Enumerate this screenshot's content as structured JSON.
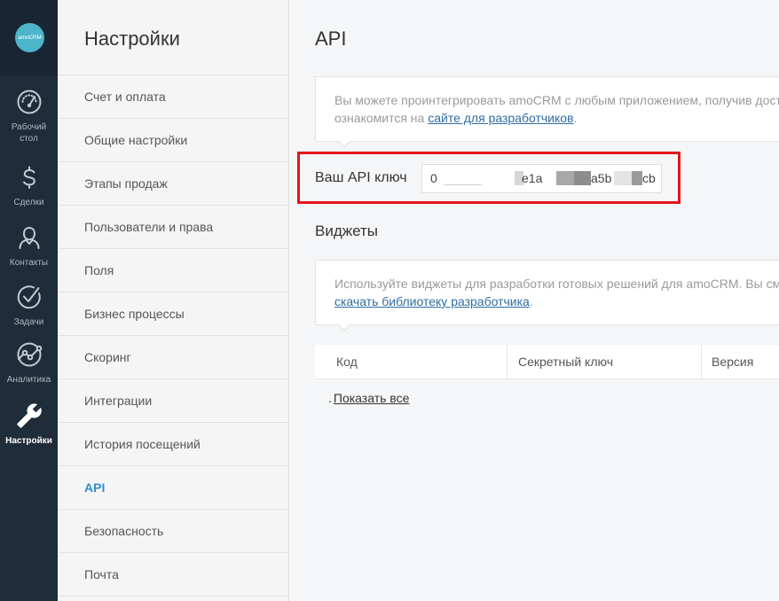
{
  "theme": {
    "sidebar_bg": "#1f2c3a",
    "logo_color": "#4db5c9",
    "accent": "#2f8fd0",
    "link": "#2f6da3",
    "highlight_border": "#e5141b"
  },
  "sidebar": {
    "logo_text": "amoCRM",
    "items": [
      {
        "label": "Рабочий стол",
        "icon": "dashboard-gauge-icon",
        "active": false
      },
      {
        "label": "Сделки",
        "icon": "dollar-icon",
        "active": false
      },
      {
        "label": "Контакты",
        "icon": "contact-person-icon",
        "active": false
      },
      {
        "label": "Задачи",
        "icon": "task-check-icon",
        "active": false
      },
      {
        "label": "Аналитика",
        "icon": "analytics-chart-icon",
        "active": false
      },
      {
        "label": "Настройки",
        "icon": "settings-wrench-icon",
        "active": true
      }
    ]
  },
  "settings_menu": {
    "title": "Настройки",
    "items": [
      {
        "label": "Счет и оплата",
        "active": false
      },
      {
        "label": "Общие настройки",
        "active": false
      },
      {
        "label": "Этапы продаж",
        "active": false
      },
      {
        "label": "Пользователи и права",
        "active": false
      },
      {
        "label": "Поля",
        "active": false
      },
      {
        "label": "Бизнес процессы",
        "active": false
      },
      {
        "label": "Скоринг",
        "active": false
      },
      {
        "label": "Интеграции",
        "active": false
      },
      {
        "label": "История посещений",
        "active": false
      },
      {
        "label": "API",
        "active": true
      },
      {
        "label": "Безопасность",
        "active": false
      },
      {
        "label": "Почта",
        "active": false
      }
    ]
  },
  "page": {
    "title": "API",
    "api_info": {
      "line1": "Вы можете проинтегрировать amoCRM с любым приложением, получив дост",
      "line2_text": "ознакомится на ",
      "line2_link": "сайте для разработчиков",
      "line2_end": "."
    },
    "api_key": {
      "label": "Ваш API ключ",
      "visible_fragments": [
        "0",
        "e1a",
        "a5b",
        "cb"
      ]
    },
    "widgets": {
      "title": "Виджеты",
      "info": {
        "line1": "Используйте виджеты для разработки готовых решений для amoCRM. Вы см",
        "line2_link": "скачать библиотеку разработчика",
        "line2_end": "."
      },
      "table": {
        "columns": [
          "Код",
          "Секретный ключ",
          "Версия"
        ]
      },
      "show_all": {
        "bullet": ".",
        "link": "Показать все"
      }
    }
  }
}
